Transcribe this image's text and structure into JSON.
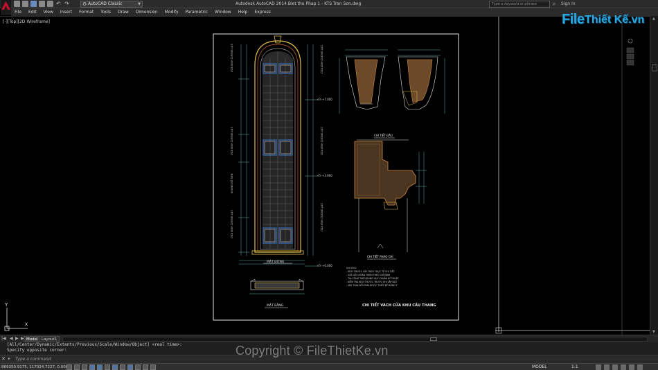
{
  "titlebar": {
    "app_title": "Autodesk AutoCAD 2014    Biet thu Phap 1 - KTS Tran Son.dwg",
    "workspace": "AutoCAD Classic",
    "search_placeholder": "Type a keyword or phrase",
    "signin": "Sign In"
  },
  "menu": [
    "File",
    "Edit",
    "View",
    "Insert",
    "Format",
    "Tools",
    "Draw",
    "Dimension",
    "Modify",
    "Parametric",
    "Window",
    "Help",
    "Express"
  ],
  "viewport": {
    "label": "[-][Top][2D Wireframe]"
  },
  "drawing": {
    "elevation_title": "MẶT ĐỨNG",
    "plan_title": "MẶT BẰNG",
    "detail1_title": "CHI TIẾT ĐẦU",
    "detail2_title": "CHI TIẾT PHÀO CHỈ",
    "main_title": "CHI TIẾT VÁCH CỬA KHU CẦU THANG",
    "notes_heading": "GHI CHÚ:",
    "notes": [
      "- KÍCH THƯỚC LẤY THEO THỰC TẾ CHI TIẾT",
      "- VẬT LIỆU HOÀN THIỆN THEO CHỈ ĐỊNH",
      "- THI CÔNG THEO ĐÚNG QUY CHUẨN KỸ THUẬT",
      "- KIỂM TRA KÍCH THƯỚC TRƯỚC KHI LẮP ĐẶT",
      "- MỌI THAY ĐỔI PHẢI ĐƯỢC THIẾT KẾ ĐỒNG Ý"
    ],
    "levels": [
      "+7.000",
      "+3.900",
      "+0.000"
    ]
  },
  "tabs": {
    "model": "Model",
    "layout1": "Layout1"
  },
  "command": {
    "history_line1": "[All/Center/Dynamic/Extents/Previous/Scale/Window/Object] <real time>:",
    "history_line2": "Specify opposite corner:",
    "input_placeholder": "Type a command"
  },
  "status": {
    "coords": "869350.9175, 117024.7227, 0.0000",
    "model": "MODEL",
    "scale": "1:1"
  },
  "watermark": {
    "logo_file": "File",
    "logo_rest": "Thiết Kế.vn",
    "copyright": "Copyright © FileThietKe.vn"
  },
  "colors": {
    "background": "#000000",
    "sheet_border": "#ffffff",
    "accent_red": "#ff2a2a",
    "accent_yellow": "#e3c04b",
    "watermark_blue": "#29a8e0"
  }
}
